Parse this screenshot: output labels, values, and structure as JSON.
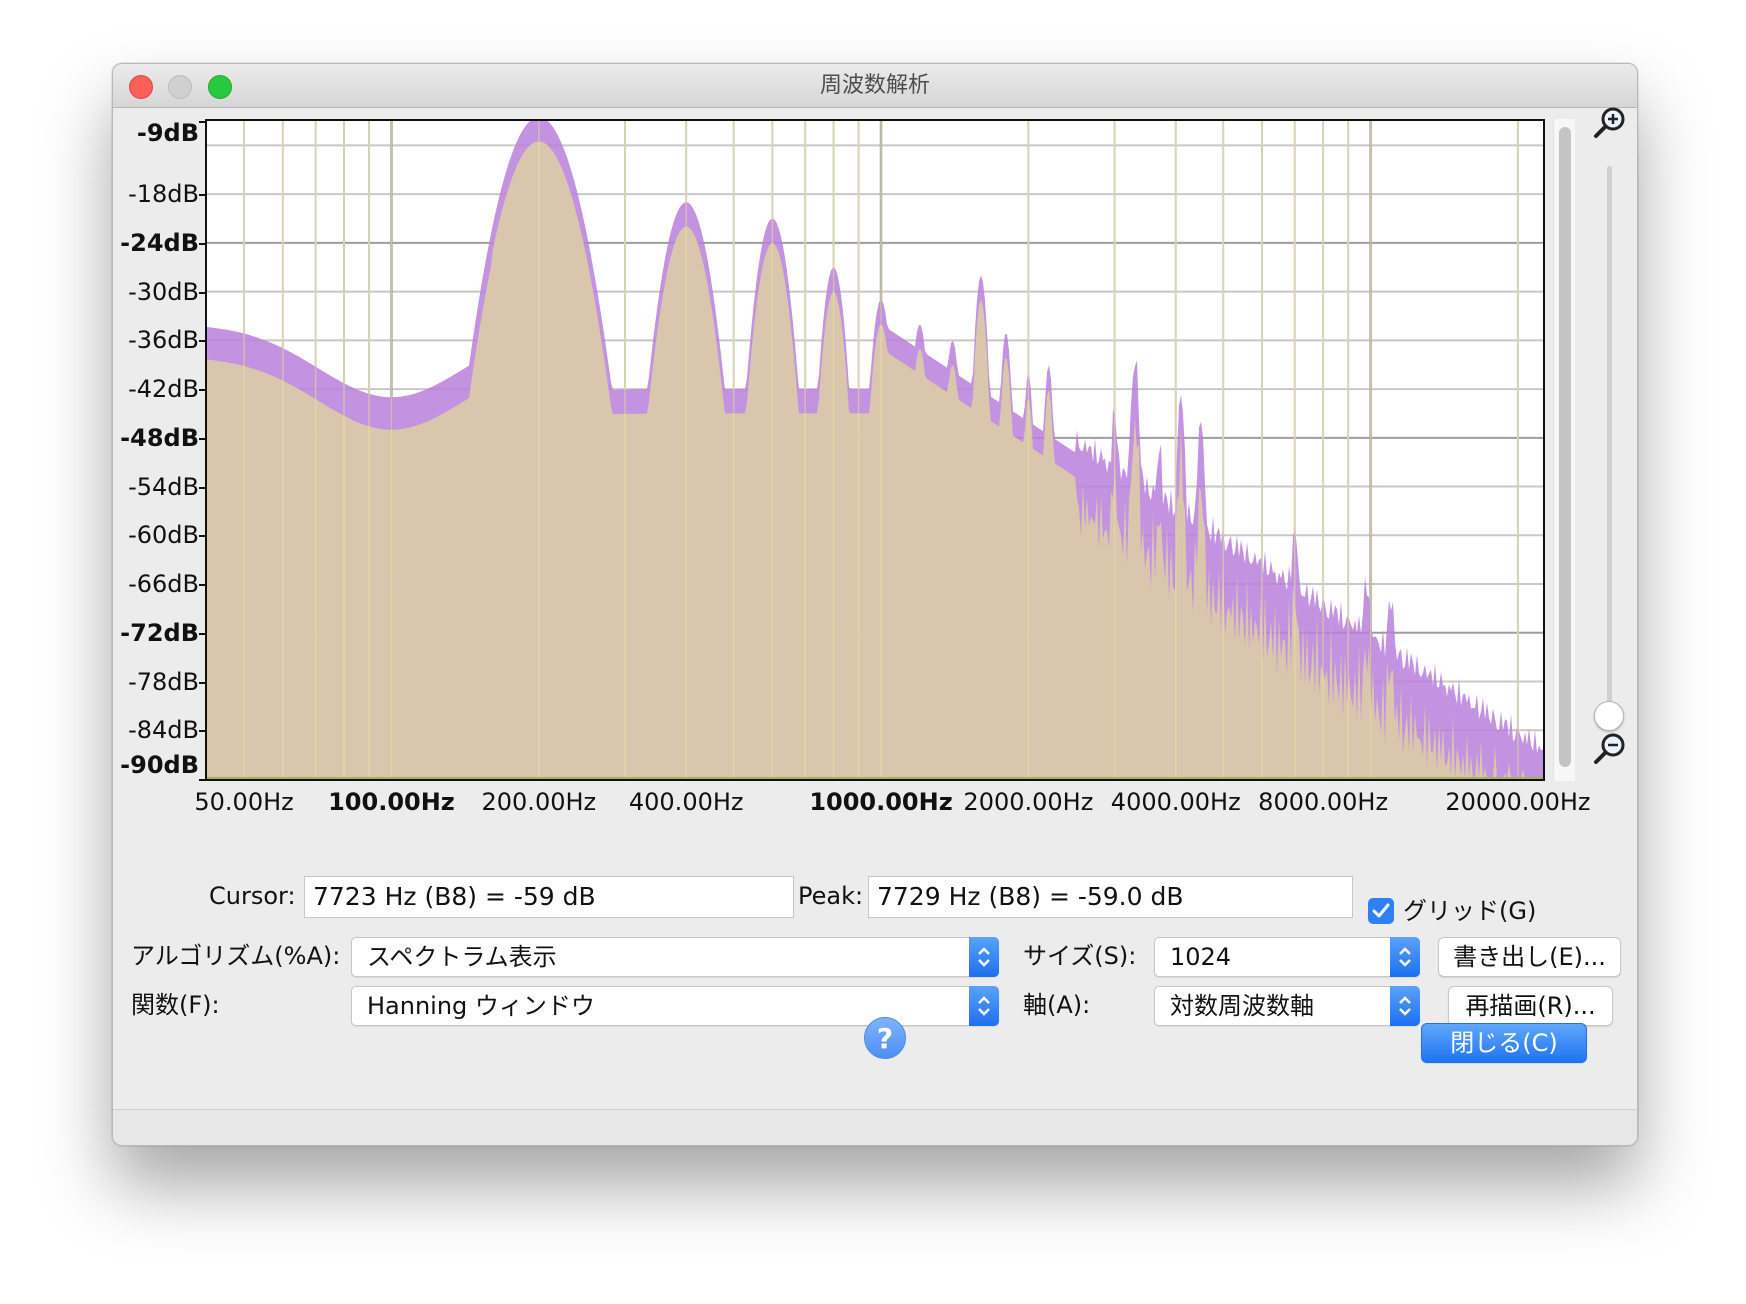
{
  "window": {
    "title": "周波数解析"
  },
  "plot": {
    "y_labels": [
      {
        "text": "-9dB",
        "bold": true
      },
      {
        "text": "-18dB",
        "bold": false
      },
      {
        "text": "-24dB",
        "bold": true
      },
      {
        "text": "-30dB",
        "bold": false
      },
      {
        "text": "-36dB",
        "bold": false
      },
      {
        "text": "-42dB",
        "bold": false
      },
      {
        "text": "-48dB",
        "bold": true
      },
      {
        "text": "-54dB",
        "bold": false
      },
      {
        "text": "-60dB",
        "bold": false
      },
      {
        "text": "-66dB",
        "bold": false
      },
      {
        "text": "-72dB",
        "bold": true
      },
      {
        "text": "-78dB",
        "bold": false
      },
      {
        "text": "-84dB",
        "bold": false
      },
      {
        "text": "-90dB",
        "bold": true
      }
    ],
    "x_labels": [
      {
        "text": "50.00Hz",
        "bold": false
      },
      {
        "text": "100.00Hz",
        "bold": true
      },
      {
        "text": "200.00Hz",
        "bold": false
      },
      {
        "text": "400.00Hz",
        "bold": false
      },
      {
        "text": "1000.00Hz",
        "bold": true
      },
      {
        "text": "2000.00Hz",
        "bold": false
      },
      {
        "text": "4000.00Hz",
        "bold": false
      },
      {
        "text": "8000.00Hz",
        "bold": false
      },
      {
        "text": "20000.00Hz",
        "bold": false
      }
    ],
    "colors": {
      "fill": "#dbc9a9",
      "outline": "#b87fdb",
      "grid": "#c8c8c8",
      "grid_major": "#9e9e9e"
    }
  },
  "cursor": {
    "label": "Cursor:",
    "value": "7723 Hz (B8) = -59 dB"
  },
  "peak": {
    "label": "Peak:",
    "value": "7729 Hz (B8) = -59.0 dB"
  },
  "grid_toggle": {
    "label": "グリッド(G)",
    "checked": true
  },
  "algorithm": {
    "label": "アルゴリズム(%A):",
    "value": "スペクトラム表示"
  },
  "function": {
    "label": "関数(F):",
    "value": "Hanning ウィンドウ"
  },
  "size": {
    "label": "サイズ(S):",
    "value": "1024"
  },
  "axis": {
    "label": "軸(A):",
    "value": "対数周波数軸"
  },
  "buttons": {
    "export": "書き出し(E)...",
    "replot": "再描画(R)...",
    "close": "閉じる(C)",
    "help": "?"
  },
  "icons": {
    "zoom_in": "zoom-in-icon",
    "zoom_out": "zoom-out-icon",
    "help": "help-icon",
    "checkmark": "checkmark-icon"
  }
}
